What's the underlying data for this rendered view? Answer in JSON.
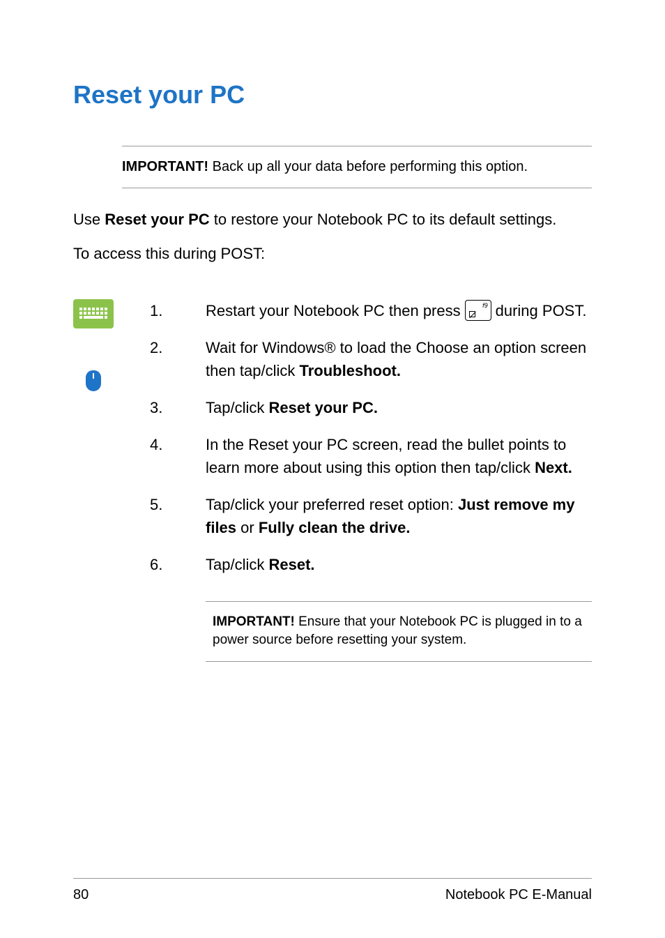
{
  "heading": "Reset your PC",
  "important1": {
    "label": "IMPORTANT!",
    "text": " Back up all your data before performing this option."
  },
  "intro": {
    "pre": "Use ",
    "strong": "Reset your PC",
    "post": " to restore your Notebook PC to its default settings."
  },
  "access": "To access this during POST:",
  "steps": {
    "s1": {
      "num": "1.",
      "pre": "Restart your Notebook PC then press ",
      "keylabel": "f9",
      "post": " during POST."
    },
    "s2": {
      "num": "2.",
      "pre": "Wait for Windows® to load the Choose an option screen then tap/click ",
      "strong": "Troubleshoot."
    },
    "s3": {
      "num": "3.",
      "pre": "Tap/click ",
      "strong": "Reset your PC."
    },
    "s4": {
      "num": "4.",
      "pre": "In the Reset your PC screen, read the bullet points to learn more about using this option then tap/click ",
      "strong": "Next."
    },
    "s5": {
      "num": "5.",
      "pre": "Tap/click your preferred reset option: ",
      "strong1": "Just remove my files",
      "mid": " or ",
      "strong2": "Fully clean the drive."
    },
    "s6": {
      "num": "6.",
      "pre": "Tap/click ",
      "strong": "Reset."
    }
  },
  "important2": {
    "label": "IMPORTANT!",
    "text": " Ensure that your Notebook PC is plugged in to a power source before resetting your system."
  },
  "footer": {
    "page": "80",
    "title": "Notebook PC E-Manual"
  }
}
